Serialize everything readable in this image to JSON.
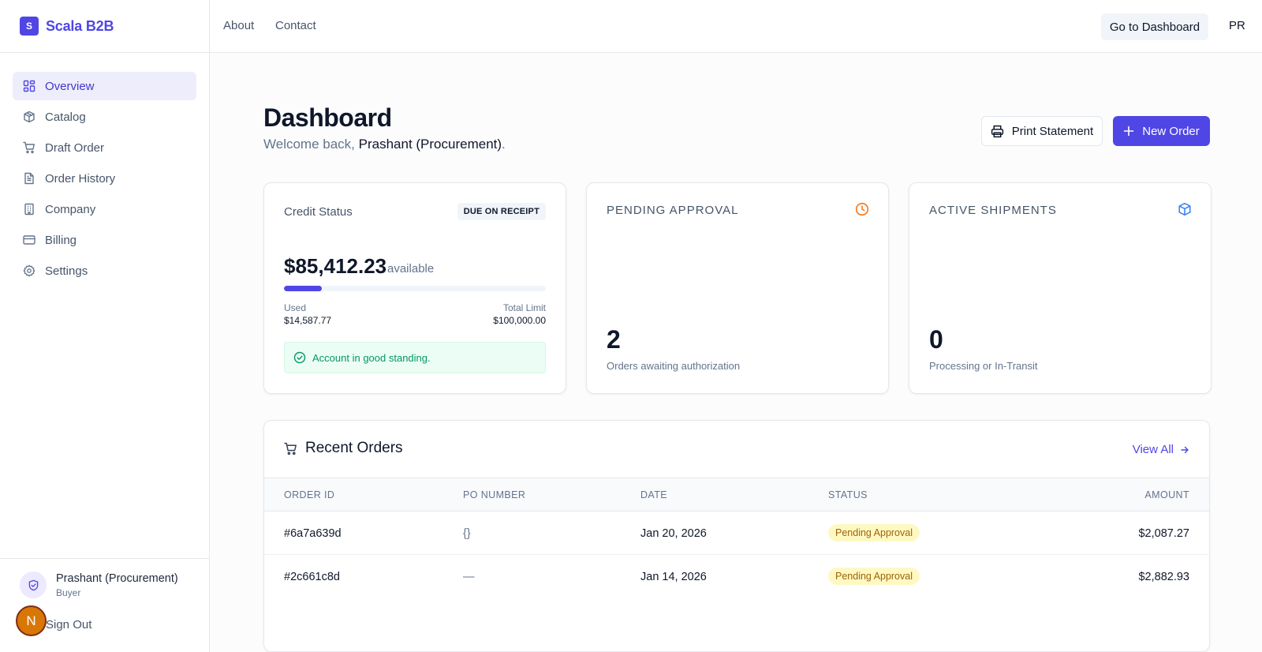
{
  "brand": {
    "logo_letter": "S",
    "name": "Scala B2B",
    "color": "#4f46e5"
  },
  "sidebar": {
    "items": [
      {
        "label": "Overview",
        "icon": "grid-icon",
        "active": true
      },
      {
        "label": "Catalog",
        "icon": "box-icon"
      },
      {
        "label": "Draft Order",
        "icon": "cart-icon"
      },
      {
        "label": "Order History",
        "icon": "file-icon"
      },
      {
        "label": "Company",
        "icon": "building-icon"
      },
      {
        "label": "Billing",
        "icon": "credit-card-icon"
      },
      {
        "label": "Settings",
        "icon": "gear-icon"
      }
    ],
    "user": {
      "name": "Prashant (Procurement)",
      "role": "Buyer"
    },
    "signout": "Sign Out",
    "floating_avatar_letter": "N"
  },
  "topnav": {
    "links": [
      "About",
      "Contact"
    ],
    "goto_dashboard": "Go to Dashboard",
    "user_initials": "PR"
  },
  "page": {
    "title": "Dashboard",
    "welcome_prefix": "Welcome back, ",
    "welcome_name": "Prashant (Procurement)",
    "welcome_suffix": ".",
    "print_button": "Print Statement",
    "new_order_button": "New Order"
  },
  "credit": {
    "title": "Credit Status",
    "badge": "DUE ON RECEIPT",
    "available_amount": "$85,412.23",
    "available_label": "available",
    "used_fraction": 0.1459,
    "used_label": "Used",
    "used_value": "$14,587.77",
    "limit_label": "Total Limit",
    "limit_value": "$100,000.00",
    "standing": "Account in good standing."
  },
  "pending": {
    "title": "PENDING APPROVAL",
    "icon": "clock-icon",
    "icon_color": "#f97316",
    "count": "2",
    "caption": "Orders awaiting authorization"
  },
  "shipments": {
    "title": "ACTIVE SHIPMENTS",
    "icon": "package-icon",
    "icon_color": "#3b82f6",
    "count": "0",
    "caption": "Processing or In-Transit"
  },
  "orders": {
    "title": "Recent Orders",
    "view_all": "View All",
    "columns": {
      "order_id": "ORDER ID",
      "po_number": "PO NUMBER",
      "date": "DATE",
      "status": "STATUS",
      "amount": "AMOUNT"
    },
    "rows": [
      {
        "order_id": "#6a7a639d",
        "po_number": "{}",
        "date": "Jan 20, 2026",
        "status": "Pending Approval",
        "amount": "$2,087.27"
      },
      {
        "order_id": "#2c661c8d",
        "po_number": "—",
        "date": "Jan 14, 2026",
        "status": "Pending Approval",
        "amount": "$2,882.93"
      }
    ]
  }
}
